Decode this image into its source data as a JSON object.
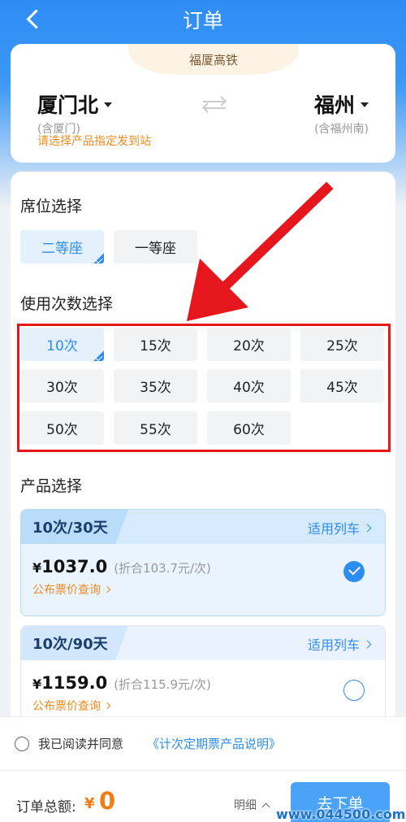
{
  "nav": {
    "title": "订单"
  },
  "route": {
    "train_type": "福厦高铁",
    "from": {
      "name": "厦门北",
      "sub": "(含厦门)"
    },
    "to": {
      "name": "福州",
      "sub": "(含福州南)"
    },
    "hint": "请选择产品指定发到站"
  },
  "seat": {
    "title": "席位选择",
    "options": [
      {
        "label": "二等座",
        "selected": true
      },
      {
        "label": "一等座",
        "selected": false
      }
    ]
  },
  "times": {
    "title": "使用次数选择",
    "options": [
      {
        "label": "10次",
        "selected": true
      },
      {
        "label": "15次",
        "selected": false
      },
      {
        "label": "20次",
        "selected": false
      },
      {
        "label": "25次",
        "selected": false
      },
      {
        "label": "30次",
        "selected": false
      },
      {
        "label": "35次",
        "selected": false
      },
      {
        "label": "40次",
        "selected": false
      },
      {
        "label": "45次",
        "selected": false
      },
      {
        "label": "50次",
        "selected": false
      },
      {
        "label": "55次",
        "selected": false
      },
      {
        "label": "60次",
        "selected": false
      }
    ]
  },
  "products": {
    "title": "产品选择",
    "items": [
      {
        "name": "10次/30天",
        "trains": "适用列车",
        "currency": "¥",
        "price": "1037.0",
        "per": "(折合103.7元/次)",
        "link": "公布票价查询",
        "selected": true
      },
      {
        "name": "10次/90天",
        "trains": "适用列车",
        "currency": "¥",
        "price": "1159.0",
        "per": "(折合115.9元/次)",
        "link": "公布票价查询",
        "selected": false
      }
    ]
  },
  "agreement": {
    "text": "我已阅读并同意",
    "link": "《计次定期票产品说明》"
  },
  "footer": {
    "total_label": "订单总额:",
    "currency": "¥",
    "total": "0",
    "detail": "明细",
    "submit": "去下单"
  },
  "watermark": "www.044500.com",
  "colors": {
    "accent": "#2d8cf0",
    "orange": "#f08a1d",
    "highlight": "#e5171d",
    "header": "#2f8cf5"
  }
}
